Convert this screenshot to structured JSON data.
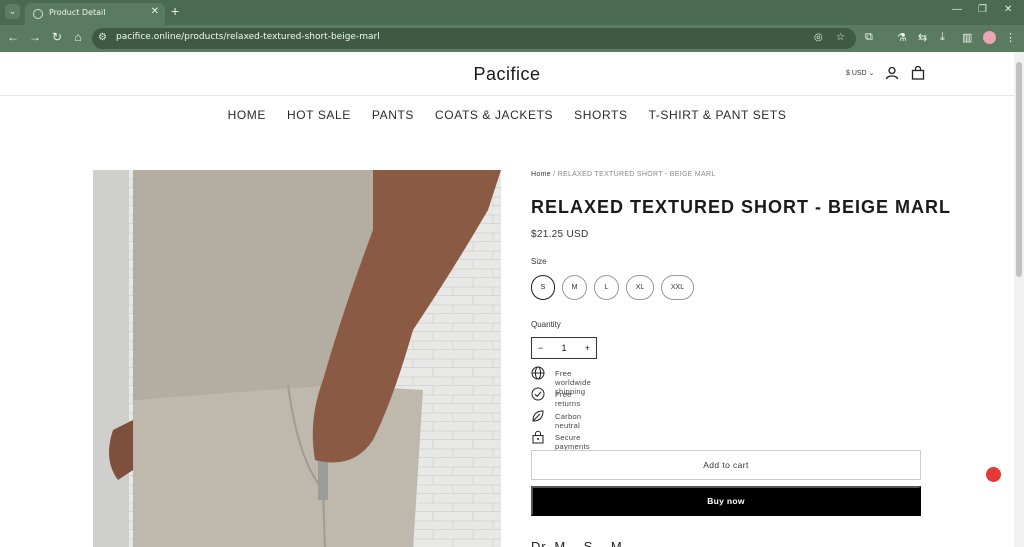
{
  "browser": {
    "tab_title": "Product Detail",
    "url": "pacifice.online/products/relaxed-textured-short-beige-marl"
  },
  "store": {
    "logo": "Pacifice",
    "currency": "$ USD"
  },
  "menu": [
    "HOME",
    "HOT SALE",
    "PANTS",
    "COATS & JACKETS",
    "SHORTS",
    "T-SHIRT & PANT SETS"
  ],
  "product": {
    "breadcrumb_home": "Home",
    "breadcrumb_current": "RELAXED TEXTURED SHORT - BEIGE MARL",
    "title": "RELAXED TEXTURED SHORT - BEIGE MARL",
    "price": "$21.25 USD",
    "size_label": "Size",
    "sizes": [
      "S",
      "M",
      "L",
      "XL",
      "XXL"
    ],
    "selected_size": "S",
    "quantity_label": "Quantity",
    "quantity": "1",
    "features": [
      "Free worldwide shipping",
      "Free returns",
      "Carbon neutral",
      "Secure payments"
    ],
    "add_to_cart": "Add to cart",
    "buy_now": "Buy now",
    "next_section_partial": "Dr. M... S... M..."
  },
  "icons": {
    "account": "user-icon",
    "cart": "bag-icon",
    "feature_icons": [
      "globe-icon",
      "check-circle-icon",
      "leaf-icon",
      "lock-icon"
    ]
  },
  "colors": {
    "browser_frame": "#4a6b4f",
    "buy_now_bg": "#000000",
    "floating_badge": "#e53935"
  }
}
